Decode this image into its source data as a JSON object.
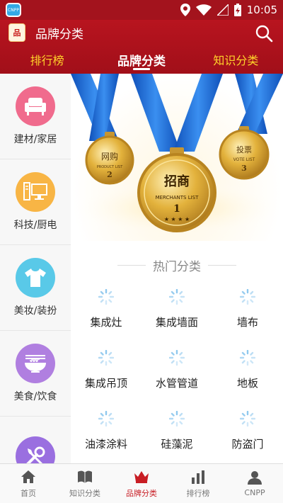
{
  "status_bar": {
    "time": "10:05",
    "left_icon": "app-notification-icon",
    "right_icons": [
      "location-icon",
      "wifi-icon",
      "signal-icon",
      "battery-icon"
    ]
  },
  "header": {
    "title": "品牌分类",
    "logo_text": "品",
    "search_icon": "search-icon",
    "tabs": [
      {
        "label": "排行榜"
      },
      {
        "label": "品牌分类",
        "active": true
      },
      {
        "label": "知识分类"
      }
    ]
  },
  "sidebar": {
    "items": [
      {
        "label": "建材/家居",
        "icon": "sofa-icon",
        "color": "#f06b8d"
      },
      {
        "label": "科技/厨电",
        "icon": "computer-icon",
        "color": "#f8b545"
      },
      {
        "label": "美妆/装扮",
        "icon": "tshirt-icon",
        "color": "#59c9e8"
      },
      {
        "label": "美食/饮食",
        "icon": "noodle-bowl-icon",
        "color": "#b07fe0"
      },
      {
        "label": "",
        "icon": "tools-icon",
        "color": "#9a6fe0"
      }
    ]
  },
  "banner": {
    "medals": [
      {
        "title": "网购",
        "sub": "PRODUCT LIST",
        "rank": "2"
      },
      {
        "title": "招商",
        "sub": "MERCHANTS LIST",
        "rank": "1"
      },
      {
        "title": "投票",
        "sub": "VOTE LIST",
        "rank": "3"
      }
    ]
  },
  "section": {
    "title": "热门分类"
  },
  "categories": [
    {
      "label": "集成灶"
    },
    {
      "label": "集成墙面"
    },
    {
      "label": "墙布"
    },
    {
      "label": "集成吊顶"
    },
    {
      "label": "水管管道"
    },
    {
      "label": "地板"
    },
    {
      "label": "油漆涂料"
    },
    {
      "label": "硅藻泥"
    },
    {
      "label": "防盗门"
    }
  ],
  "bottom_nav": {
    "items": [
      {
        "label": "首页",
        "icon": "home-icon"
      },
      {
        "label": "知识分类",
        "icon": "book-icon"
      },
      {
        "label": "品牌分类",
        "icon": "crown-icon",
        "active": true
      },
      {
        "label": "排行榜",
        "icon": "bar-chart-icon"
      },
      {
        "label": "CNPP",
        "icon": "user-icon"
      }
    ]
  },
  "colors": {
    "primary_red": "#a3131d",
    "tab_yellow": "#ffd42a",
    "active_nav": "#c81d24",
    "ribbon_blue": "#1a6fe0",
    "gold": "#e3b23c"
  }
}
